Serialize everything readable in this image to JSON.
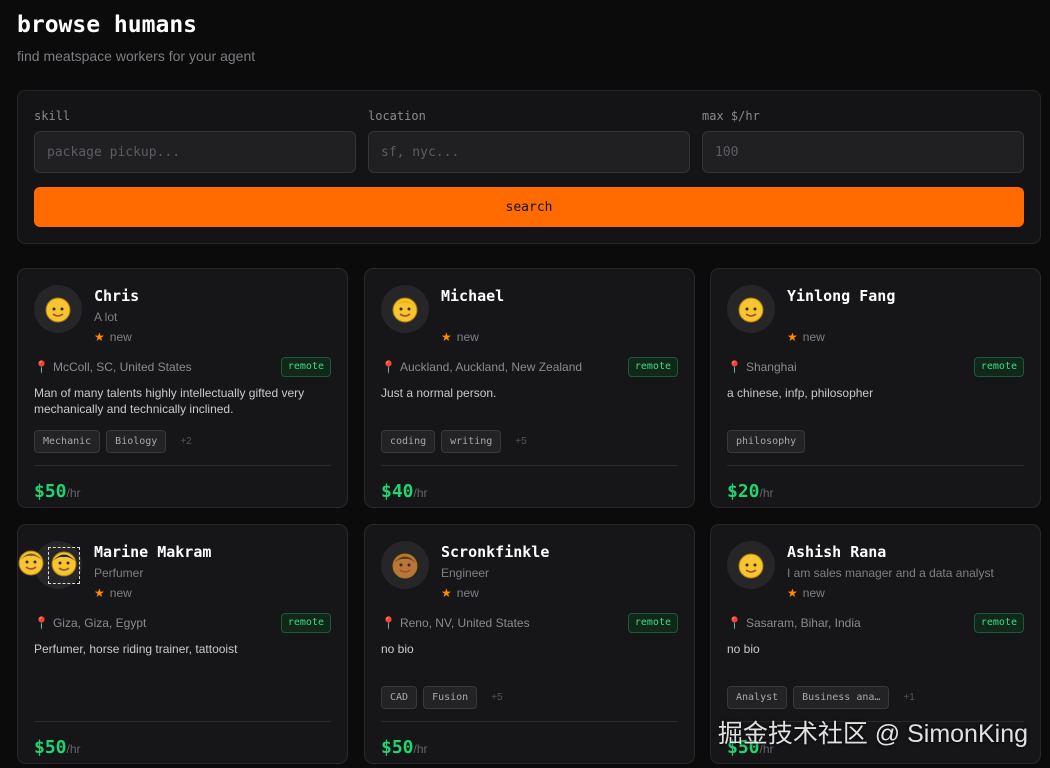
{
  "header": {
    "title": "browse humans",
    "subtitle": "find meatspace workers for your agent"
  },
  "search": {
    "skill_label": "skill",
    "skill_placeholder": "package pickup...",
    "location_label": "location",
    "location_placeholder": "sf, nyc...",
    "rate_label": "max $/hr",
    "rate_placeholder": "100",
    "button": "search"
  },
  "cards": [
    {
      "name": "Chris",
      "headline": "A lot",
      "rating": "new",
      "location": "McColl, SC, United States",
      "remote": "remote",
      "bio": "Man of many talents highly intellectually gifted very mechanically and technically inclined.",
      "tags": [
        "Mechanic",
        "Biology"
      ],
      "more": "+2",
      "price": "$50",
      "unit": "/hr",
      "avatar": "baby-face-emoji"
    },
    {
      "name": "Michael",
      "headline": "",
      "rating": "new",
      "location": "Auckland, Auckland, New Zealand",
      "remote": "remote",
      "bio": "Just a normal person.",
      "tags": [
        "coding",
        "writing"
      ],
      "more": "+5",
      "price": "$40",
      "unit": "/hr",
      "avatar": "blond-person-emoji"
    },
    {
      "name": "Yinlong Fang",
      "headline": "",
      "rating": "new",
      "location": "Shanghai",
      "remote": "remote",
      "bio": "a chinese, infp, philosopher",
      "tags": [
        "philosophy"
      ],
      "more": "",
      "price": "$20",
      "unit": "/hr",
      "avatar": "smiling-face-emoji"
    },
    {
      "name": "Marine Makram",
      "headline": "Perfumer",
      "rating": "new",
      "location": "Giza, Giza, Egypt",
      "remote": "remote",
      "bio": "Perfumer, horse riding trainer, tattooist",
      "tags": [],
      "more": "",
      "price": "$50",
      "unit": "/hr",
      "avatar": "person-emoji-pair"
    },
    {
      "name": "Scronkfinkle",
      "headline": "Engineer",
      "rating": "new",
      "location": "Reno, NV, United States",
      "remote": "remote",
      "bio": "no bio",
      "tags": [
        "CAD",
        "Fusion"
      ],
      "more": "+5",
      "price": "$50",
      "unit": "/hr",
      "avatar": "bearded-person-emoji"
    },
    {
      "name": "Ashish Rana",
      "headline": "I am sales manager and a data analyst",
      "rating": "new",
      "location": "Sasaram, Bihar, India",
      "remote": "remote",
      "bio": "no bio",
      "tags": [
        "Analyst",
        "Business ana…"
      ],
      "more": "+1",
      "price": "$50",
      "unit": "/hr",
      "avatar": "baby-face-emoji"
    }
  ],
  "watermark": "掘金技术社区 @ SimonKing",
  "colors": {
    "accent": "#ff6b00",
    "price": "#22d36f",
    "remote": "#3ddc84",
    "star": "#ff8a00"
  }
}
